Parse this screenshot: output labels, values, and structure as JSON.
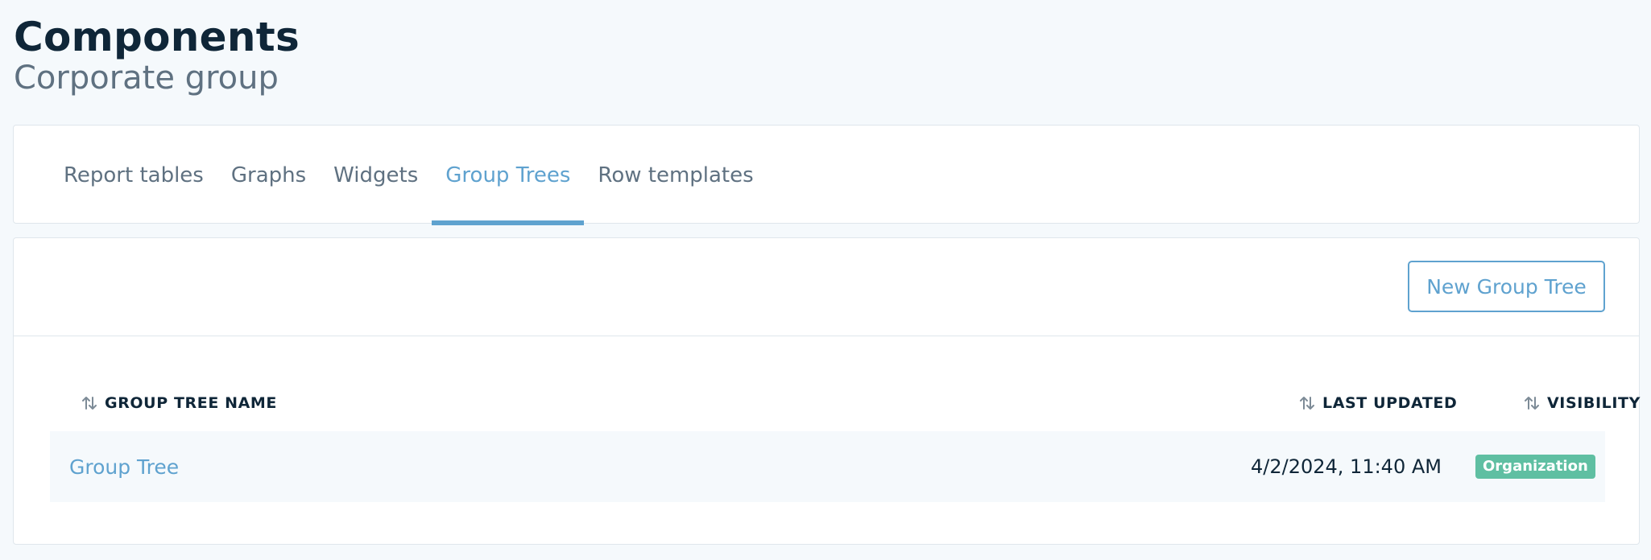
{
  "header": {
    "title": "Components",
    "subtitle": "Corporate group"
  },
  "tabs": [
    {
      "label": "Report tables",
      "active": false
    },
    {
      "label": "Graphs",
      "active": false
    },
    {
      "label": "Widgets",
      "active": false
    },
    {
      "label": "Group Trees",
      "active": true
    },
    {
      "label": "Row templates",
      "active": false
    }
  ],
  "toolbar": {
    "new_button_label": "New Group Tree"
  },
  "table": {
    "columns": [
      {
        "label": "GROUP TREE NAME",
        "icon": "sort-icon"
      },
      {
        "label": "LAST UPDATED",
        "icon": "sort-icon"
      },
      {
        "label": "VISIBILITY",
        "icon": "sort-icon"
      }
    ],
    "rows": [
      {
        "name": "Group Tree",
        "last_updated": "4/2/2024, 11:40 AM",
        "visibility": "Organization"
      }
    ]
  },
  "colors": {
    "accent": "#5fa2cf",
    "badge": "#5fbfa2",
    "title": "#0f2638",
    "muted": "#5f7181"
  }
}
